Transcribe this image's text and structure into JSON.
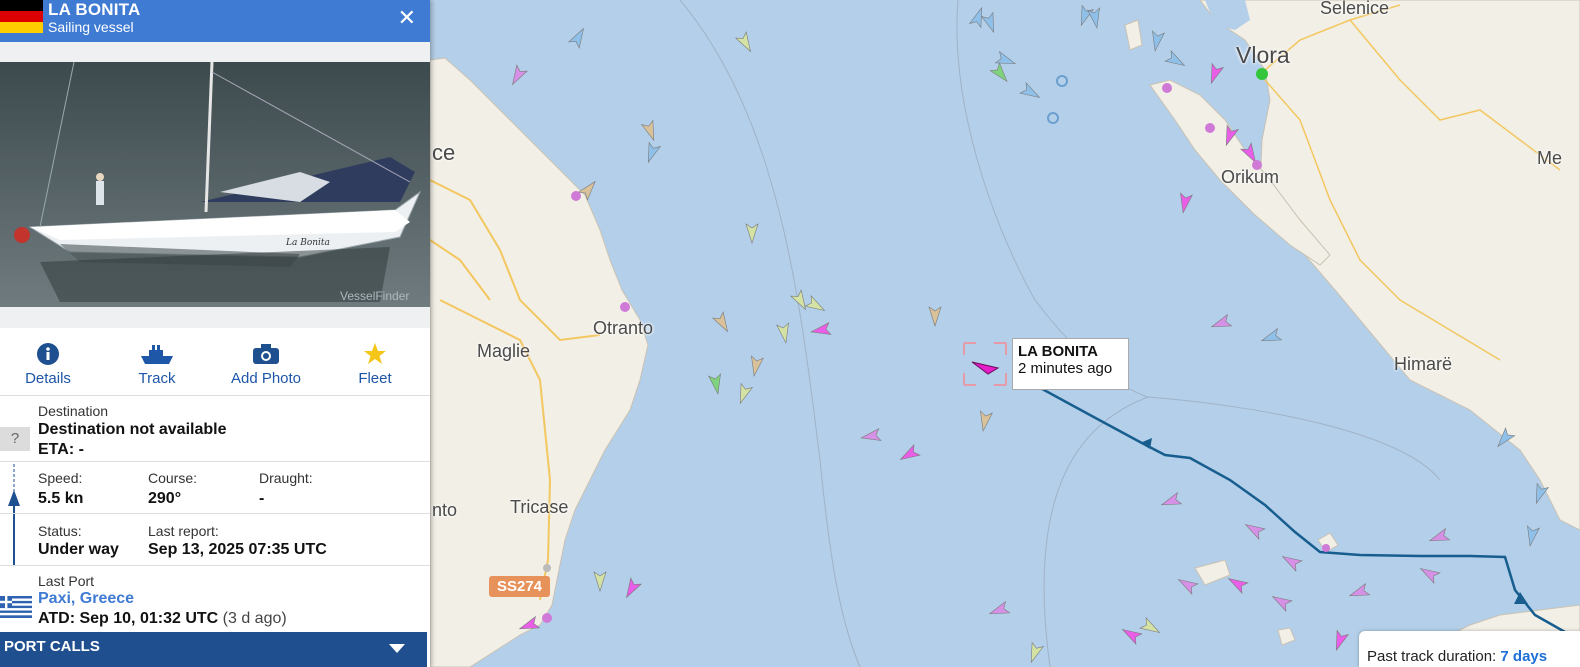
{
  "vessel": {
    "name": "LA BONITA",
    "type": "Sailing vessel",
    "flag_colors": [
      "#000000",
      "#dd0000",
      "#ffce00"
    ],
    "photo_watermark": "VesselFinder",
    "hull_name": "La Bonita"
  },
  "actions": [
    {
      "label": "Details",
      "icon": "info-icon"
    },
    {
      "label": "Track",
      "icon": "ship-icon"
    },
    {
      "label": "Add Photo",
      "icon": "camera-icon"
    },
    {
      "label": "Fleet",
      "icon": "star-icon"
    }
  ],
  "destination": {
    "label": "Destination",
    "value": "Destination not available",
    "eta": "ETA: -",
    "icon_glyph": "?"
  },
  "nav": {
    "speed_label": "Speed:",
    "speed": "5.5 kn",
    "course_label": "Course:",
    "course": "290°",
    "draught_label": "Draught:",
    "draught": "-",
    "status_label": "Status:",
    "status": "Under way",
    "report_label": "Last report:",
    "report": "Sep 13, 2025 07:35 UTC"
  },
  "last_port": {
    "label": "Last Port",
    "port": "Paxi, Greece",
    "atd": "ATD: Sep 10, 01:32 UTC",
    "ago": "(3 d ago)"
  },
  "port_calls": "PORT CALLS",
  "map": {
    "places": [
      {
        "id": "vlora",
        "name": "Vlora",
        "big": true
      },
      {
        "id": "selenice",
        "name": "Selenice"
      },
      {
        "id": "orikum",
        "name": "Orikum"
      },
      {
        "id": "himare",
        "name": "Himarë"
      },
      {
        "id": "otranto",
        "name": "Otranto"
      },
      {
        "id": "maglie",
        "name": "Maglie"
      },
      {
        "id": "tricase",
        "name": "Tricase"
      },
      {
        "id": "lecce-cut",
        "name": "ce"
      },
      {
        "id": "nto-cut",
        "name": "nto"
      },
      {
        "id": "me-cut",
        "name": "Me"
      }
    ],
    "road_badge": "SS274",
    "vessel_label": {
      "name": "LA BONITA",
      "time": "2 minutes ago"
    },
    "track": {
      "text": "Past track duration:",
      "value": "7 days"
    },
    "colors": {
      "sea": "#b4cfe9",
      "land": "#f2efe6",
      "track": "#175e8f",
      "selected": "#e41ec8"
    }
  }
}
